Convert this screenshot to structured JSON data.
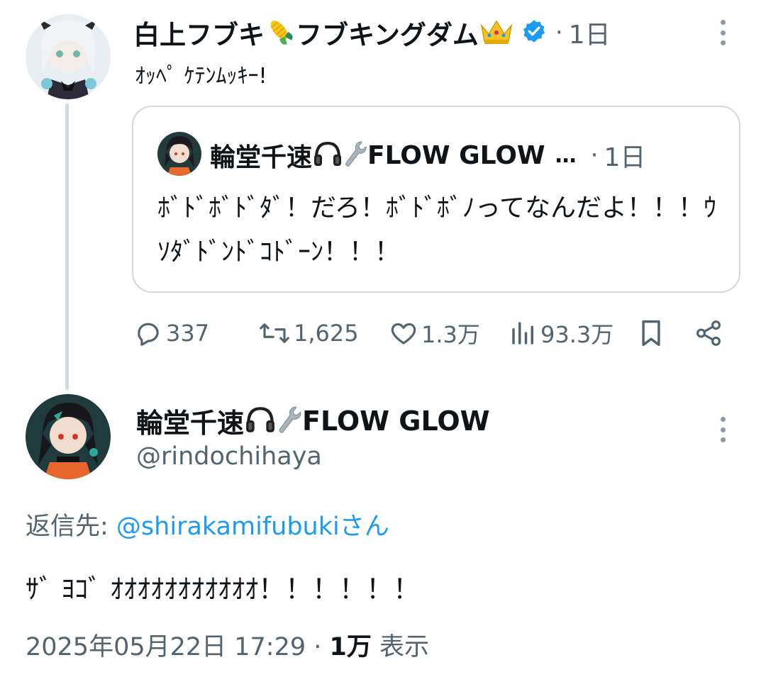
{
  "thread": {
    "parent": {
      "display_name": "白上フブキ",
      "display_name_suffix": "フブキングダム",
      "name_emojis": [
        "corn",
        "crown"
      ],
      "verified": true,
      "time_sep": "·",
      "time": "1日",
      "text": "ｵｯﾍﾟ ｹﾃﾝﾑｯｷｰ!",
      "quote": {
        "display_name": "輪堂千速",
        "display_name_suffix": "FLOW GLOW",
        "name_emojis": [
          "headphones",
          "wrench"
        ],
        "ellipsis": "…",
        "time_sep": "·",
        "time": "1日",
        "text": "ﾎﾞﾄﾞﾎﾞﾄﾞﾀﾞ！だろ！ﾎﾞﾄﾞﾎﾞﾉってなんだよ！！！ｳｿﾀﾞﾄﾞﾝﾄﾞｺﾄﾞｰﾝ！！！"
      },
      "actions": {
        "reply_count": "337",
        "retweet_count": "1,625",
        "like_count": "1.3万",
        "view_count": "93.3万"
      }
    },
    "main": {
      "display_name": "輪堂千速",
      "display_name_suffix": "FLOW GLOW",
      "name_emojis": [
        "headphones",
        "wrench"
      ],
      "handle": "@rindochihaya",
      "reply_prefix": "返信先: ",
      "reply_mention": "@shirakamifubuki",
      "reply_suffix": "さん",
      "text": "ｻﾞ ﾖｺﾞ ｵｵｵｵｵｵｵｵｵｵｵ！！！！！！",
      "date": "2025年05月22日 17:29",
      "sep": " · ",
      "views": "1万",
      "views_label": " 表示"
    }
  },
  "icons": {
    "reply": "reply-icon",
    "retweet": "retweet-icon",
    "like": "heart-icon",
    "views": "views-bar-icon",
    "bookmark": "bookmark-icon",
    "share": "share-icon",
    "more": "more-vertical-icon",
    "verified": "verified-badge-icon"
  },
  "colors": {
    "text": "#0f1419",
    "secondary": "#536471",
    "link": "#1d9bf0",
    "border": "#cfd9de",
    "verified": "#1d9bf0"
  }
}
